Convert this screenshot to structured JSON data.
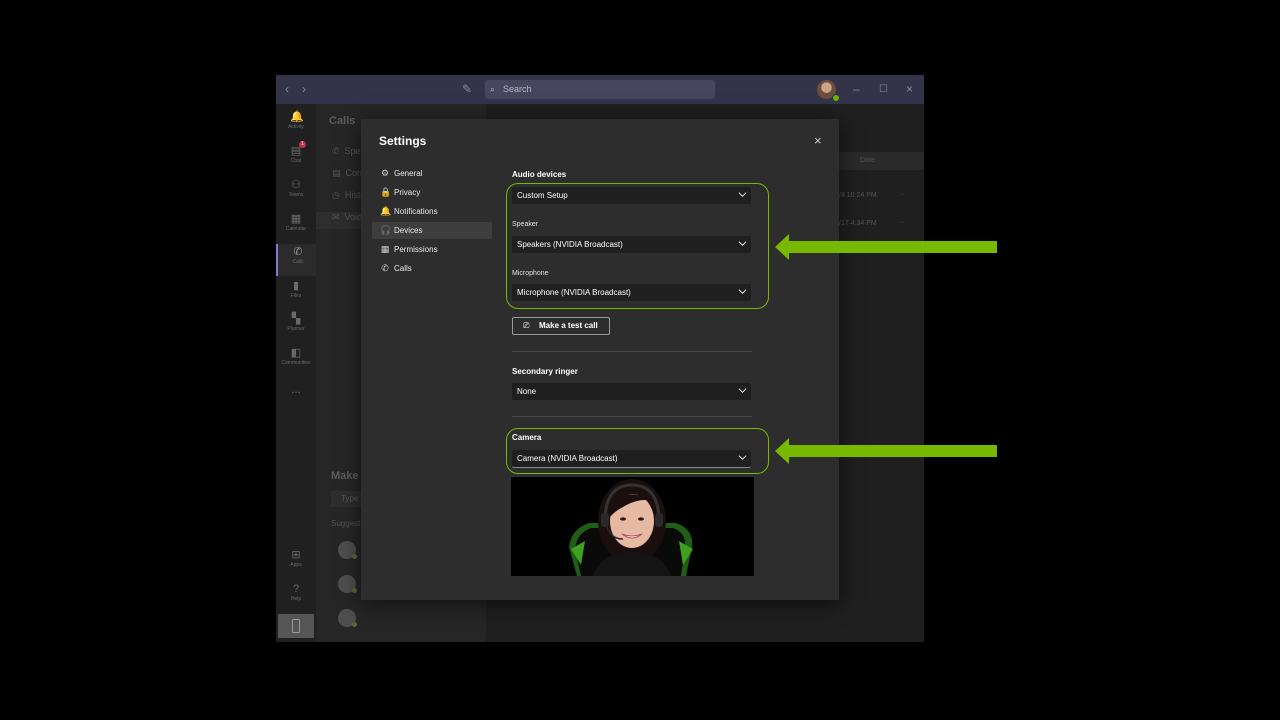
{
  "window": {
    "search_placeholder": "Search",
    "rail": [
      {
        "label": "Activity",
        "icon": "bell-icon"
      },
      {
        "label": "Chat",
        "icon": "chat-icon",
        "badge": "1"
      },
      {
        "label": "Teams",
        "icon": "teams-icon"
      },
      {
        "label": "Calendar",
        "icon": "calendar-icon"
      },
      {
        "label": "Calls",
        "icon": "phone-icon"
      },
      {
        "label": "Files",
        "icon": "file-icon"
      },
      {
        "label": "Planner",
        "icon": "planner-icon"
      },
      {
        "label": "Communities",
        "icon": "communities-icon"
      },
      {
        "label": "...",
        "icon": "more-icon"
      },
      {
        "label": "Apps",
        "icon": "apps-icon"
      },
      {
        "label": "Help",
        "icon": "help-icon"
      }
    ],
    "calls_pane": {
      "title": "Calls",
      "items": [
        "Spee",
        "Cont",
        "Histo",
        "Voic"
      ],
      "make_call": "Make",
      "type_placeholder": "Type",
      "suggested": "Suggest"
    },
    "main": {
      "date_header": "Date",
      "rows": [
        "/8 10:24 PM",
        "/17 4:34 PM"
      ]
    }
  },
  "settings": {
    "title": "Settings",
    "close_glyph": "×",
    "nav": [
      {
        "label": "General",
        "icon": "gear-icon",
        "glyph": "⚙"
      },
      {
        "label": "Privacy",
        "icon": "lock-icon",
        "glyph": "🔒"
      },
      {
        "label": "Notifications",
        "icon": "bell-icon",
        "glyph": "🔔"
      },
      {
        "label": "Devices",
        "icon": "headset-icon",
        "glyph": "🎧",
        "active": true
      },
      {
        "label": "Permissions",
        "icon": "permissions-icon",
        "glyph": "▦"
      },
      {
        "label": "Calls",
        "icon": "phone-icon",
        "glyph": "✆"
      }
    ],
    "audio_devices": {
      "heading": "Audio devices",
      "value": "Custom Setup",
      "speaker_label": "Speaker",
      "speaker_value": "Speakers (NVIDIA Broadcast)",
      "microphone_label": "Microphone",
      "microphone_value": "Microphone (NVIDIA Broadcast)"
    },
    "test_call_label": "Make a test call",
    "secondary_ringer": {
      "heading": "Secondary ringer",
      "value": "None"
    },
    "camera": {
      "heading": "Camera",
      "value": "Camera (NVIDIA Broadcast)"
    }
  },
  "colors": {
    "highlight": "#76b900",
    "titlebar": "#33344a",
    "dialog": "#2d2d2d"
  }
}
